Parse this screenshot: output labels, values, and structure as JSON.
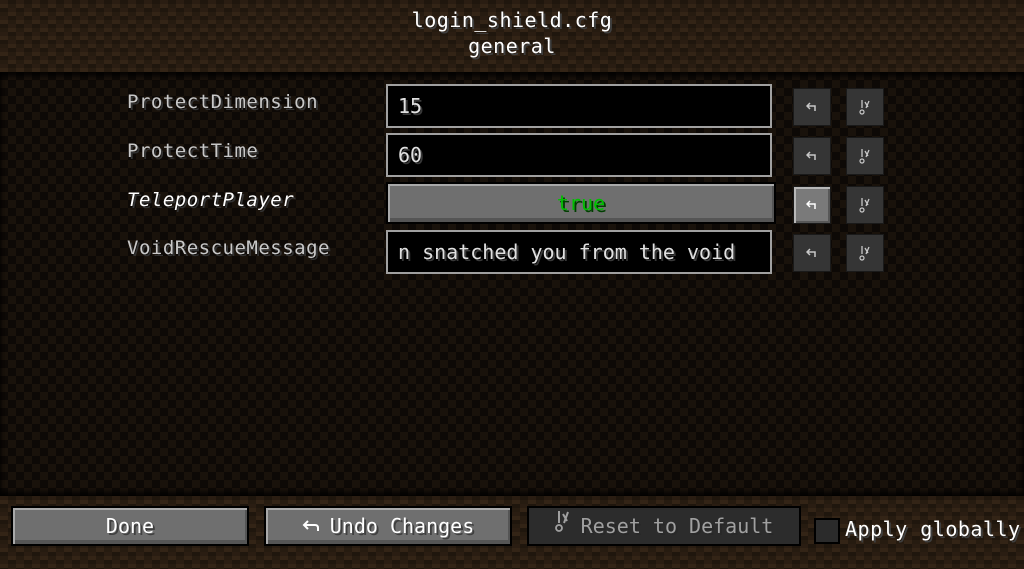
{
  "header": {
    "title": "login_shield.cfg",
    "subtitle": "general"
  },
  "entries": [
    {
      "label": "ProtectDimension",
      "type": "text",
      "value": "15",
      "modified": false,
      "undo_icon": "undo-arrow-icon",
      "reset_icon": "reset-default-icon"
    },
    {
      "label": "ProtectTime",
      "type": "text",
      "value": "60",
      "modified": false,
      "undo_icon": "undo-arrow-icon",
      "reset_icon": "reset-default-icon"
    },
    {
      "label": "TeleportPlayer",
      "type": "toggle",
      "value": "true",
      "modified": true,
      "value_color": "#00c000",
      "undo_icon": "undo-arrow-icon",
      "reset_icon": "reset-default-icon"
    },
    {
      "label": "VoidRescueMessage",
      "type": "text",
      "value": "n snatched you from the void",
      "modified": false,
      "undo_icon": "undo-arrow-icon",
      "reset_icon": "reset-default-icon"
    }
  ],
  "footer": {
    "done_label": "Done",
    "undo_label": "Undo Changes",
    "undo_icon": "undo-arrow-icon",
    "reset_label": "Reset to Default",
    "reset_icon": "reset-default-icon",
    "apply_globally_label": "Apply globally",
    "apply_globally_checked": false
  }
}
